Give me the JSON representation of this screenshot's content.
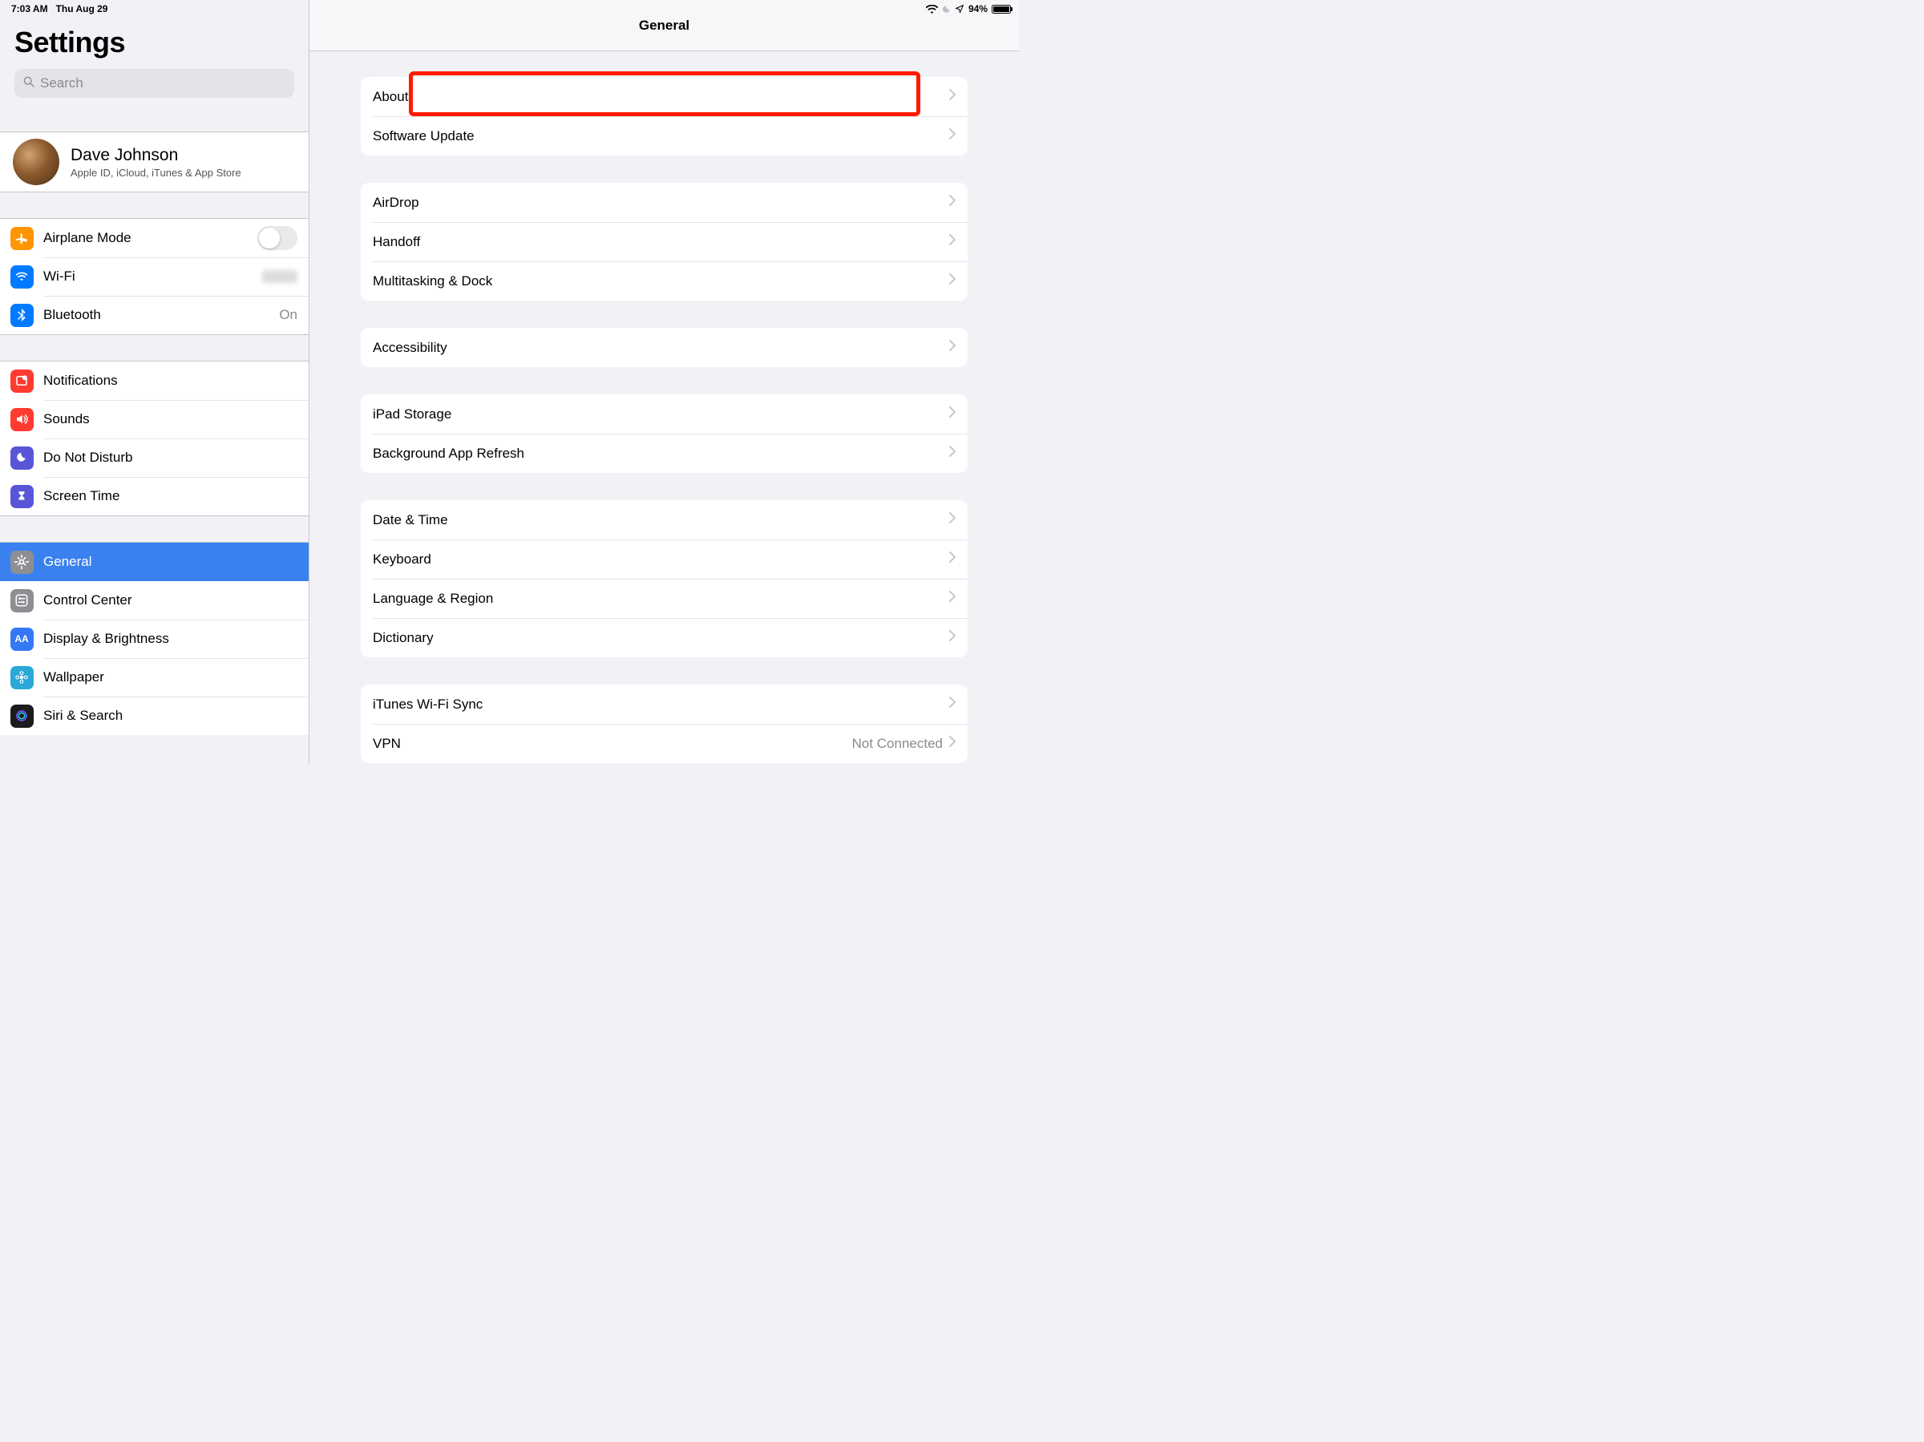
{
  "status": {
    "time": "7:03 AM",
    "date": "Thu Aug 29",
    "battery_pct": "94%"
  },
  "sidebar": {
    "title": "Settings",
    "search_placeholder": "Search",
    "profile_name": "Dave Johnson",
    "profile_sub": "Apple ID, iCloud, iTunes & App Store",
    "airplane": "Airplane Mode",
    "wifi": "Wi-Fi",
    "wifi_value": "",
    "bluetooth": "Bluetooth",
    "bluetooth_value": "On",
    "notifications": "Notifications",
    "sounds": "Sounds",
    "dnd": "Do Not Disturb",
    "screentime": "Screen Time",
    "general": "General",
    "controlcenter": "Control Center",
    "display": "Display & Brightness",
    "wallpaper": "Wallpaper",
    "siri": "Siri & Search"
  },
  "detail": {
    "title": "General",
    "about": "About",
    "software_update": "Software Update",
    "airdrop": "AirDrop",
    "handoff": "Handoff",
    "multitask": "Multitasking & Dock",
    "accessibility": "Accessibility",
    "storage": "iPad Storage",
    "bgrefresh": "Background App Refresh",
    "datetime": "Date & Time",
    "keyboard": "Keyboard",
    "language": "Language & Region",
    "dictionary": "Dictionary",
    "itunes_sync": "iTunes Wi-Fi Sync",
    "vpn": "VPN",
    "vpn_value": "Not Connected"
  },
  "highlight_target": "about"
}
